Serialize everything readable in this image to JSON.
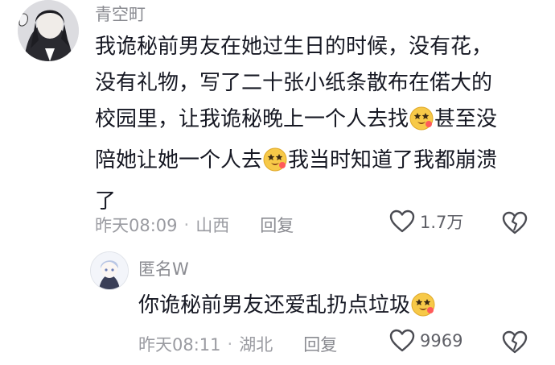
{
  "comments": [
    {
      "username": "青空町",
      "text_lines": [
        "我诡秘前男友在她过生日的时候，没有花，",
        "没有礼物，写了二十张小纸条散布在偌大的",
        "校园里，让我诡秘晚上一个人去找",
        "甚至没",
        "陪她让她一个人去",
        "我当时知道了我都崩溃",
        "了"
      ],
      "time": "昨天08:09",
      "location": "山西",
      "reply_label": "回复",
      "likes": "1.7万"
    },
    {
      "username": "匿名W",
      "text": "你诡秘前男友还爱乱扔点垃圾",
      "time": "昨天08:11",
      "location": "湖北",
      "reply_label": "回复",
      "likes": "9969"
    }
  ],
  "separator": "·",
  "icons": {
    "like": "heart-outline-icon",
    "dislike": "broken-heart-icon",
    "emoji": "star-eyes-emoji-icon"
  },
  "colors": {
    "text": "#161823",
    "secondary": "#9a9ba1",
    "emoji": "#f7c948"
  }
}
